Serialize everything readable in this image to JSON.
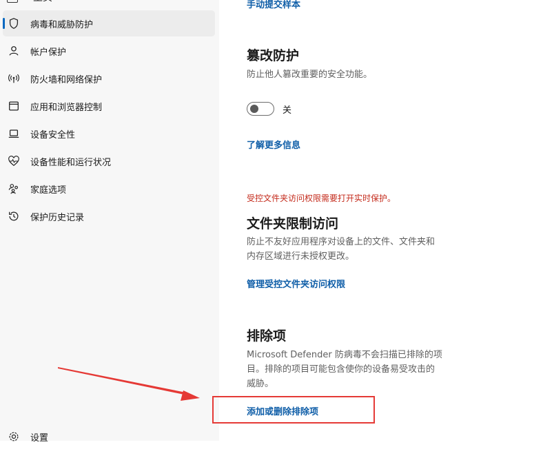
{
  "sidebar": {
    "partial_top_label": "主页",
    "items": [
      {
        "label": "病毒和威胁防护",
        "icon": "shield-icon",
        "active": true
      },
      {
        "label": "帐户保护",
        "icon": "person-icon",
        "active": false
      },
      {
        "label": "防火墙和网络保护",
        "icon": "wifi-antenna-icon",
        "active": false
      },
      {
        "label": "应用和浏览器控制",
        "icon": "app-window-icon",
        "active": false
      },
      {
        "label": "设备安全性",
        "icon": "laptop-icon",
        "active": false
      },
      {
        "label": "设备性能和运行状况",
        "icon": "heart-pulse-icon",
        "active": false
      },
      {
        "label": "家庭选项",
        "icon": "family-icon",
        "active": false
      },
      {
        "label": "保护历史记录",
        "icon": "history-icon",
        "active": false
      }
    ],
    "settings_label": "设置"
  },
  "main": {
    "manual_submit_link": "手动提交样本",
    "tamper": {
      "title": "篡改防护",
      "description": "防止他人篡改重要的安全功能。",
      "toggle_state": "关",
      "learn_more": "了解更多信息"
    },
    "folder": {
      "warning": "受控文件夹访问权限需要打开实时保护。",
      "title": "文件夹限制访问",
      "description_line1": "防止不友好应用程序对设备上的文件、文件夹和",
      "description_line2": "内存区域进行未授权更改。",
      "manage_link": "管理受控文件夹访问权限"
    },
    "exclusions": {
      "title": "排除项",
      "description_line1": "Microsoft Defender 防病毒不会扫描已排除的项",
      "description_line2": "目。排除的项目可能包含使你的设备易受攻击的",
      "description_line3": "威胁。",
      "add_remove_link": "添加或删除排除项"
    }
  },
  "colors": {
    "accent": "#0067c0",
    "link": "#0f5ea8",
    "warning": "#c42b1c",
    "annotation_red": "#e53935"
  }
}
